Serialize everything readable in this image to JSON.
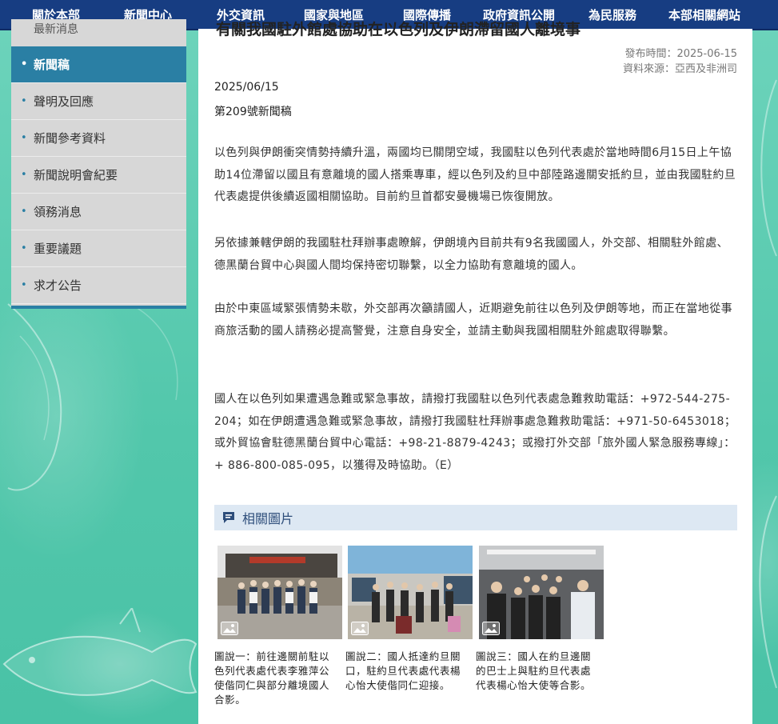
{
  "nav": {
    "items": [
      "關於本部",
      "新聞中心",
      "外交資訊",
      "國家與地區",
      "國際傳播",
      "政府資訊公開",
      "為民服務",
      "本部相關網站"
    ]
  },
  "sidebar": {
    "previous_item": "最新消息",
    "items": [
      {
        "label": "新聞稿",
        "active": true
      },
      {
        "label": "聲明及回應",
        "active": false
      },
      {
        "label": "新聞參考資料",
        "active": false
      },
      {
        "label": "新聞說明會紀要",
        "active": false
      },
      {
        "label": "領務消息",
        "active": false
      },
      {
        "label": "重要議題",
        "active": false
      },
      {
        "label": "求才公告",
        "active": false
      }
    ]
  },
  "article": {
    "title": "有關我國駐外館處協助在以色列及伊朗滯留國人離境事",
    "published": "發布時間：2025-06-15",
    "source": "資料來源：亞西及非洲司",
    "date": "2025/06/15",
    "press_no": "第209號新聞稿",
    "paragraphs": [
      "以色列與伊朗衝突情勢持續升溫，兩國均已關閉空域，我國駐以色列代表處於當地時間6月15日上午協助14位滯留以國且有意離境的國人搭乘專車，經以色列及約旦中部陸路邊關安抵約旦，並由我國駐約旦代表處提供後續返國相關協助。目前約旦首都安曼機場已恢復開放。",
      "另依據兼轄伊朗的我國駐杜拜辦事處瞭解，伊朗境內目前共有9名我國國人，外交部、相關駐外館處、德黑蘭台貿中心與國人間均保持密切聯繫，以全力協助有意離境的國人。",
      "由於中東區域緊張情勢未歇，外交部再次籲請國人，近期避免前往以色列及伊朗等地，而正在當地從事商旅活動的國人請務必提高警覺，注意自身安全，並請主動與我國相關駐外館處取得聯繫。",
      "國人在以色列如果遭遇急難或緊急事故，請撥打我國駐以色列代表處急難救助電話：+972-544-275-204；如在伊朗遭遇急難或緊急事故，請撥打我國駐杜拜辦事處急難救助電話：+971-50-6453018；或外貿協會駐德黑蘭台貿中心電話：+98-21-8879-4243；或撥打外交部「旅外國人緊急服務專線」：+ 886-800-085-095，以獲得及時協助。（E）"
    ]
  },
  "photos": {
    "header": "相關圖片",
    "items": [
      {
        "caption": "圖說一：前往邊關前駐以色列代表處代表李雅萍公使偕同仁與部分離境國人合影。"
      },
      {
        "caption": "圖說二：國人抵達約旦關口，駐約旦代表處代表楊心怡大使偕同仁迎接。"
      },
      {
        "caption": "圖說三：國人在約旦邊關的巴士上與駐約旦代表處代表楊心怡大使等合影。"
      }
    ]
  },
  "colors": {
    "nav_bg": "#173d82",
    "sidebar_active": "#2a7fa4",
    "background": "#5fcdb3"
  }
}
